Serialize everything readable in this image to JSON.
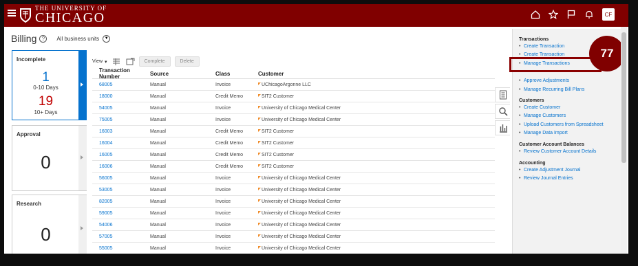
{
  "header": {
    "logo_small": "THE UNIVERSITY OF",
    "logo_big": "CHICAGO",
    "avatar": "CF",
    "brand_color": "#800000"
  },
  "page": {
    "title": "Billing",
    "business_units": "All business units"
  },
  "queues": {
    "incomplete": {
      "label": "Incomplete",
      "count_recent": "1",
      "recent_label": "0-10 Days",
      "count_old": "19",
      "old_label": "10+ Days"
    },
    "approval": {
      "label": "Approval",
      "count": "0"
    },
    "research": {
      "label": "Research",
      "count": "0"
    }
  },
  "toolbar": {
    "view": "View",
    "complete": "Complete",
    "delete": "Delete"
  },
  "grid": {
    "columns": [
      "Transaction Number",
      "Source",
      "Class",
      "Customer"
    ],
    "rows": [
      [
        "68005",
        "Manual",
        "Invoice",
        "UChicagoArgonne LLC"
      ],
      [
        "18000",
        "Manual",
        "Credit Memo",
        "SIT2 Customer"
      ],
      [
        "54005",
        "Manual",
        "Invoice",
        "University of Chicago Medical Center"
      ],
      [
        "75005",
        "Manual",
        "Invoice",
        "University of Chicago Medical Center"
      ],
      [
        "16003",
        "Manual",
        "Credit Memo",
        "SIT2 Customer"
      ],
      [
        "16004",
        "Manual",
        "Credit Memo",
        "SIT2 Customer"
      ],
      [
        "16005",
        "Manual",
        "Credit Memo",
        "SIT2 Customer"
      ],
      [
        "16006",
        "Manual",
        "Credit Memo",
        "SIT2 Customer"
      ],
      [
        "56005",
        "Manual",
        "Invoice",
        "University of Chicago Medical Center"
      ],
      [
        "53005",
        "Manual",
        "Invoice",
        "University of Chicago Medical Center"
      ],
      [
        "82005",
        "Manual",
        "Invoice",
        "University of Chicago Medical Center"
      ],
      [
        "59005",
        "Manual",
        "Invoice",
        "University of Chicago Medical Center"
      ],
      [
        "54006",
        "Manual",
        "Invoice",
        "University of Chicago Medical Center"
      ],
      [
        "57005",
        "Manual",
        "Invoice",
        "University of Chicago Medical Center"
      ],
      [
        "55005",
        "Manual",
        "Invoice",
        "University of Chicago Medical Center"
      ]
    ]
  },
  "tasks": {
    "transactions_heading": "Transactions",
    "create_transaction": "Create Transaction",
    "hidden_item": "Create Transaction",
    "manage_transactions": "Manage Transactions",
    "approve_adjustments": "Approve Adjustments",
    "manage_recurring": "Manage Recurring Bill Plans",
    "customers_heading": "Customers",
    "create_customer": "Create Customer",
    "manage_customers": "Manage Customers",
    "upload_customers": "Upload Customers from Spreadsheet",
    "manage_data_import": "Manage Data Import",
    "balances_heading": "Customer Account Balances",
    "review_balances": "Review Customer Account Details",
    "accounting_heading": "Accounting",
    "create_adjustment": "Create Adjustment Journal",
    "review_journal": "Review Journal Entries"
  },
  "callout": {
    "step": "77"
  }
}
